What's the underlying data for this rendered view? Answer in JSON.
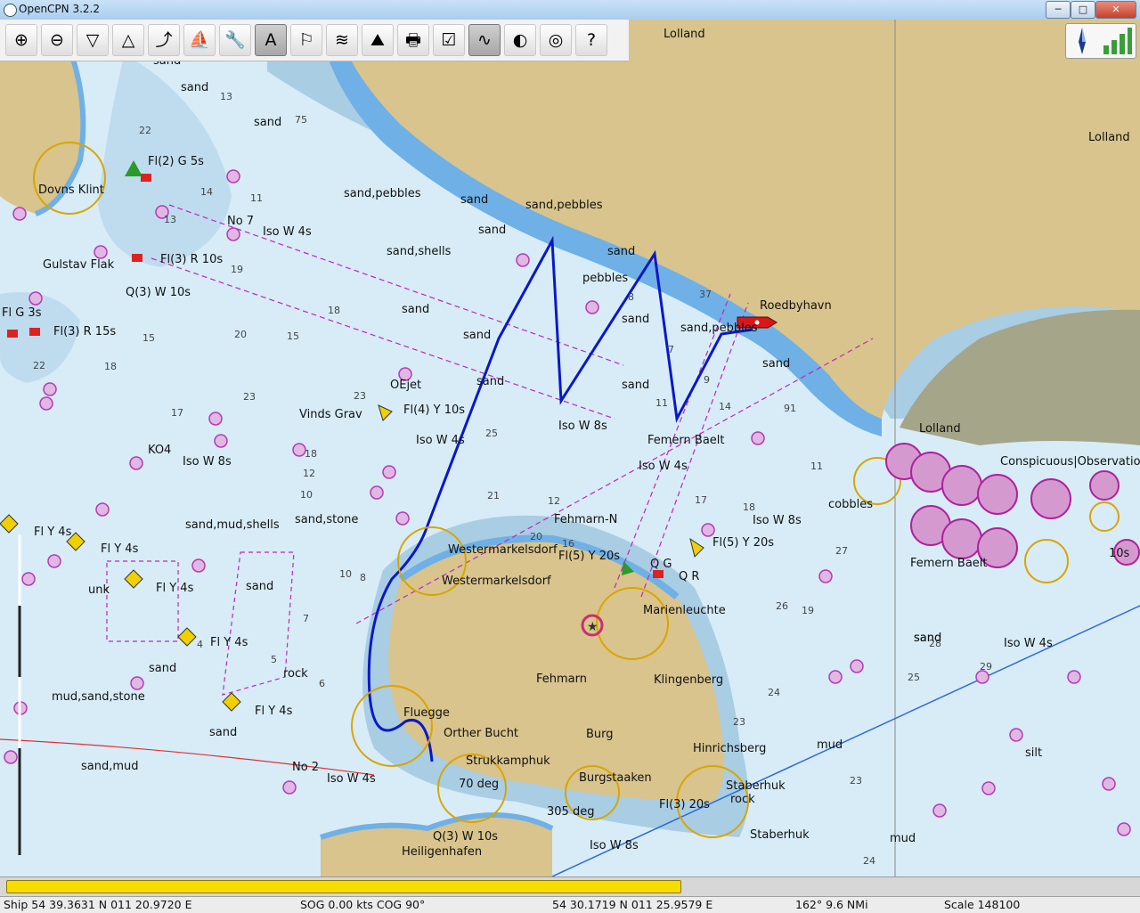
{
  "window": {
    "title": "OpenCPN 3.2.2",
    "minimize_glyph": "─",
    "maximize_glyph": "□",
    "close_glyph": "✕"
  },
  "toolbar": {
    "buttons": [
      {
        "name": "zoom-in",
        "glyph": "⊕"
      },
      {
        "name": "zoom-out",
        "glyph": "⊖"
      },
      {
        "name": "scale-in",
        "glyph": "▽"
      },
      {
        "name": "scale-out",
        "glyph": "△"
      },
      {
        "name": "route",
        "glyph": "⤴"
      },
      {
        "name": "auto-follow",
        "glyph": "⛵"
      },
      {
        "name": "settings",
        "glyph": "🔧"
      },
      {
        "name": "text",
        "glyph": "A"
      },
      {
        "name": "current",
        "glyph": "⚐"
      },
      {
        "name": "tide",
        "glyph": "≋"
      },
      {
        "name": "cm93",
        "glyph": "⛰"
      },
      {
        "name": "print",
        "glyph": "🖶"
      },
      {
        "name": "route-manager",
        "glyph": "☑"
      },
      {
        "name": "track",
        "glyph": "∿"
      },
      {
        "name": "color-scheme",
        "glyph": "◐"
      },
      {
        "name": "mob",
        "glyph": "◎"
      },
      {
        "name": "help",
        "glyph": "?"
      }
    ]
  },
  "status": {
    "ship": "Ship 54 39.3631 N   011 20.9720 E",
    "sog_cog": "SOG 0.00 kts   COG 90°",
    "cursor": "54 30.1719 N   011 25.9579 E",
    "bearing_distance": "162°  9.6 NMi",
    "scale": "Scale 148100"
  },
  "progress_fraction": 0.6,
  "chart": {
    "place_names": [
      {
        "id": "lolland-top",
        "text": "Lolland"
      },
      {
        "id": "lolland-right",
        "text": "Lolland"
      },
      {
        "id": "lolland-mid",
        "text": "Lolland"
      },
      {
        "id": "roedbyhavn",
        "text": "Roedbyhavn"
      },
      {
        "id": "dovns-klint",
        "text": "Dovns Klint"
      },
      {
        "id": "gulstav-flak",
        "text": "Gulstav Flak"
      },
      {
        "id": "vinds-grav",
        "text": "Vinds Grav"
      },
      {
        "id": "oejet",
        "text": "OEjet"
      },
      {
        "id": "femern-baelt",
        "text": "Femern Baelt"
      },
      {
        "id": "fehmarn-n",
        "text": "Fehmarn-N"
      },
      {
        "id": "westermarkelsdorf",
        "text": "Westermarkelsdorf"
      },
      {
        "id": "westermarkelsdorf-2",
        "text": "Westermarkelsdorf"
      },
      {
        "id": "marienleuchte",
        "text": "Marienleuchte"
      },
      {
        "id": "fehmarn",
        "text": "Fehmarn"
      },
      {
        "id": "klingenberg",
        "text": "Klingenberg"
      },
      {
        "id": "flugge",
        "text": "Fluegge"
      },
      {
        "id": "orther-bucht",
        "text": "Orther Bucht"
      },
      {
        "id": "burg",
        "text": "Burg"
      },
      {
        "id": "hinrichsberg",
        "text": "Hinrichsberg"
      },
      {
        "id": "strukkamphuk",
        "text": "Strukkamphuk"
      },
      {
        "id": "burgstaaken",
        "text": "Burgstaaken"
      },
      {
        "id": "staberhuk",
        "text": "Staberhuk"
      },
      {
        "id": "staberhuk-2",
        "text": "Staberhuk"
      },
      {
        "id": "heiligenhafen",
        "text": "Heiligenhafen"
      },
      {
        "id": "femern-baelt-2",
        "text": "Femern Baelt"
      }
    ],
    "seabed_labels": [
      "sand",
      "sand",
      "sand",
      "sand,pebbles",
      "sand",
      "sand,pebbles",
      "sand",
      "sand,shells",
      "sand",
      "pebbles",
      "sand",
      "sand",
      "sand",
      "sand",
      "sand",
      "sand,pebbles",
      "sand",
      "cobbles",
      "sand,mud,shells",
      "sand,stone",
      "sand",
      "unk",
      "sand",
      "mud,sand,stone",
      "rock",
      "sand",
      "sand,mud",
      "sand",
      "rock",
      "mud",
      "silt",
      "mud",
      "sand"
    ],
    "light_labels": [
      "Fl(2) G 5s",
      "No 7",
      "Iso W 4s",
      "Fl(3) R 10s",
      "Q(3) W 10s",
      "Fl G 3s",
      "Fl(3) R 15s",
      "Fl(4) Y 10s",
      "Iso W 4s",
      "Iso W 8s",
      "KO4",
      "Iso W 8s",
      "Iso W 4s",
      "Fl Y 4s",
      "Fl Y 4s",
      "Fl Y 4s",
      "Fl Y 4s",
      "Fl Y 4s",
      "Fl(5) Y 20s",
      "Q G",
      "Q R",
      "Iso W 8s",
      "Fl(5) Y 20s",
      "Iso W 4s",
      "No 2",
      "Iso W 4s",
      "70 deg",
      "305 deg",
      "Q(3) W 10s",
      "Iso W 8s",
      "Fl(3) 20s",
      "Conspicuous|Observation|Vertical",
      "10s"
    ],
    "depth_labels": [
      "22",
      "13",
      "75",
      "14",
      "11",
      "13",
      "19",
      "18",
      "20",
      "15",
      "15",
      "18",
      "22",
      "23",
      "17",
      "18",
      "23",
      "12",
      "10",
      "10",
      "8",
      "7",
      "6",
      "5",
      "4",
      "25",
      "21",
      "20",
      "16",
      "12",
      "8",
      "7",
      "9",
      "11",
      "14",
      "17",
      "18",
      "19",
      "24",
      "23",
      "26",
      "27",
      "28",
      "29",
      "25",
      "37",
      "91",
      "11",
      "23",
      "24"
    ]
  }
}
